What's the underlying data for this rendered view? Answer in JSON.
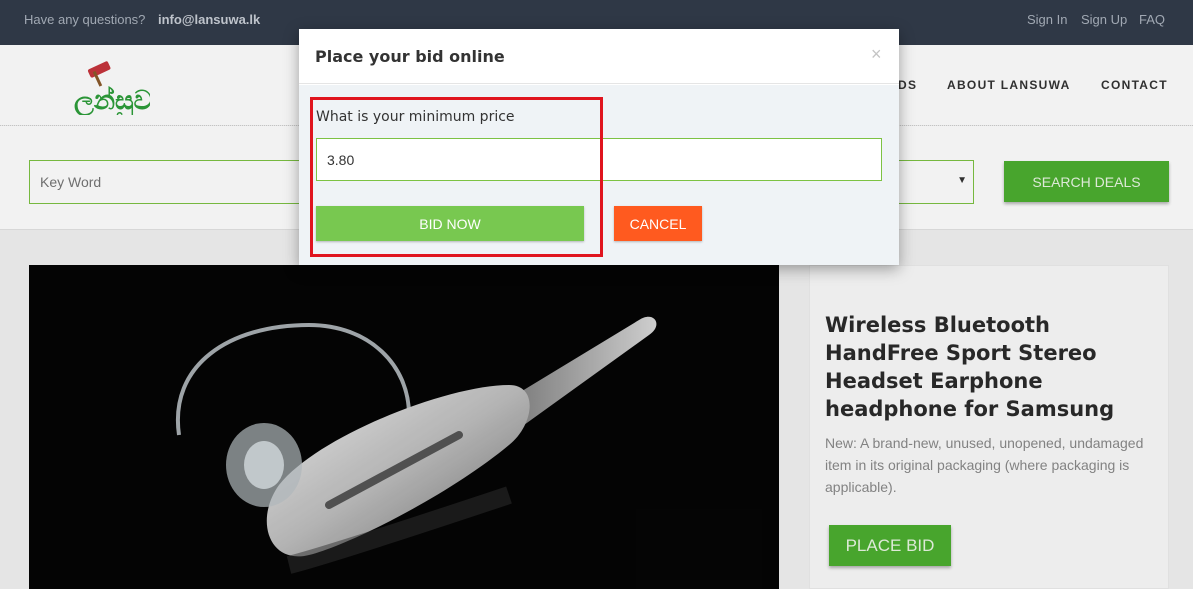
{
  "topbar": {
    "question": "Have any questions?",
    "email": "info@lansuwa.lk",
    "links": [
      "Sign In",
      "Sign Up",
      "FAQ"
    ]
  },
  "header": {
    "logo_text": "ලන්සුව",
    "nav": [
      "DS",
      "ABOUT LANSUWA",
      "CONTACT"
    ]
  },
  "search": {
    "keyword_placeholder": "Key Word",
    "button_label": "SEARCH DEALS"
  },
  "product": {
    "title": "Wireless Bluetooth HandFree Sport Stereo Headset Earphone headphone for Samsung",
    "description": "New: A brand-new, unused, unopened, undamaged item in its original packaging (where packaging is applicable).",
    "place_bid_label": "PLACE BID"
  },
  "modal": {
    "title": "Place your bid online",
    "close_icon": "×",
    "field_label": "What is your minimum price",
    "price_value": "3.80",
    "bid_now_label": "BID NOW",
    "cancel_label": "CANCEL"
  },
  "colors": {
    "topbar": "#323c4a",
    "accent_green": "#4cae30",
    "bid_green": "#78c850",
    "cancel_orange": "#ff5a1f",
    "highlight_red": "#e0141e"
  }
}
